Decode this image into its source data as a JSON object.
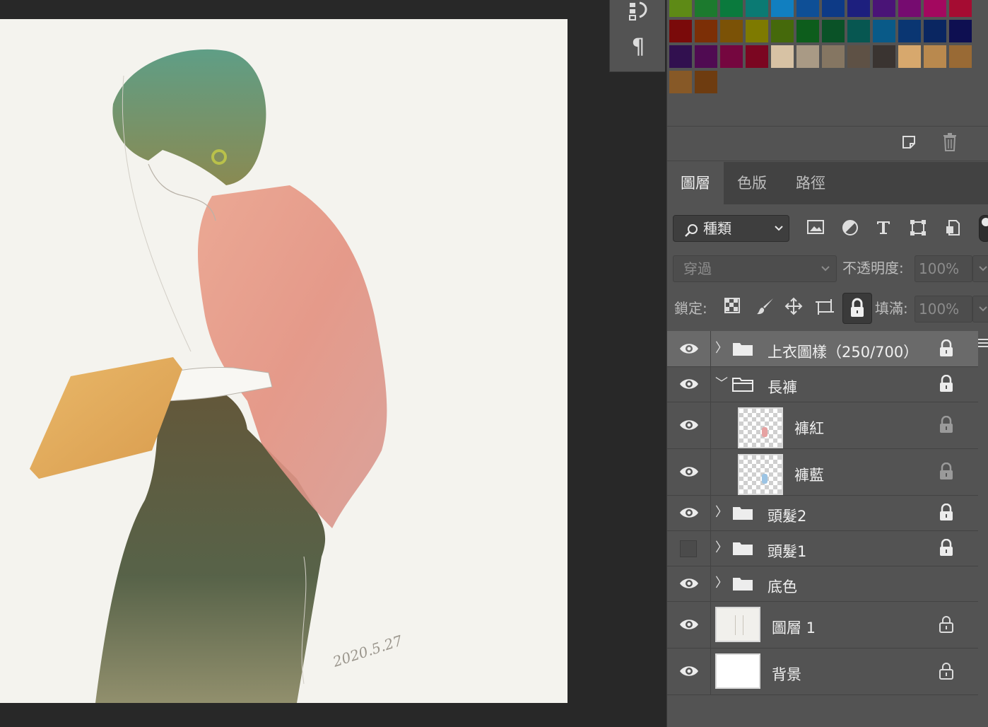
{
  "canvas": {
    "date_signature": "2020.5.27"
  },
  "tool_strip": {
    "paragraph_glyph": "¶"
  },
  "swatches": [
    "#5e8a16",
    "#1c7a2e",
    "#0a7a3d",
    "#0b7a73",
    "#117fc0",
    "#0e4f96",
    "#0d3a86",
    "#1d1f7e",
    "#4a1477",
    "#760b70",
    "#a3085f",
    "#a50c32",
    "#7a0a0a",
    "#7c2f06",
    "#7b5206",
    "#7e7a00",
    "#45690b",
    "#0d5d1c",
    "#0a5227",
    "#075751",
    "#095a88",
    "#0a3672",
    "#0a2661",
    "#0e0f51",
    "#31104f",
    "#500b52",
    "#75063f",
    "#7b0621",
    "#d7c2a4",
    "#a99a85",
    "#857662",
    "#5e5145",
    "#3a3431",
    "#d7a86d",
    "#b9894e",
    "#996a35",
    "#875927",
    "#6e3c10"
  ],
  "tabs": [
    {
      "label": "圖層",
      "active": true
    },
    {
      "label": "色版",
      "active": false
    },
    {
      "label": "路徑",
      "active": false
    }
  ],
  "filter": {
    "kind_label": "種類"
  },
  "blend": {
    "mode": "穿過",
    "opacity_label": "不透明度:",
    "opacity_value": "100%"
  },
  "lock_row": {
    "label": "鎖定:",
    "fill_label": "填滿:",
    "fill_value": "100%"
  },
  "layers": [
    {
      "name": "上衣圖樣（250/700）",
      "type": "group",
      "expanded": false,
      "visible": true,
      "locked": true,
      "selected": true,
      "indent": 0
    },
    {
      "name": "長褲",
      "type": "group",
      "expanded": true,
      "visible": true,
      "locked": true,
      "selected": false,
      "indent": 0
    },
    {
      "name": "褲紅",
      "type": "layer",
      "visible": true,
      "locked": true,
      "lock_dim": true,
      "indent": 1,
      "thumb": "checker-red"
    },
    {
      "name": "褲藍",
      "type": "layer",
      "visible": true,
      "locked": true,
      "lock_dim": true,
      "indent": 1,
      "thumb": "checker-blue"
    },
    {
      "name": "頭髮2",
      "type": "group",
      "expanded": false,
      "visible": true,
      "locked": true,
      "indent": 0
    },
    {
      "name": "頭髮1",
      "type": "group",
      "expanded": false,
      "visible": false,
      "locked": true,
      "indent": 0
    },
    {
      "name": "底色",
      "type": "group",
      "expanded": false,
      "visible": true,
      "locked": false,
      "indent": 0
    },
    {
      "name": "圖層 1",
      "type": "layer",
      "visible": true,
      "locked": true,
      "lock_open": true,
      "indent": 0,
      "thumb": "sketch"
    },
    {
      "name": "背景",
      "type": "layer",
      "visible": true,
      "locked": true,
      "lock_open": true,
      "indent": 0,
      "thumb": "white"
    }
  ]
}
